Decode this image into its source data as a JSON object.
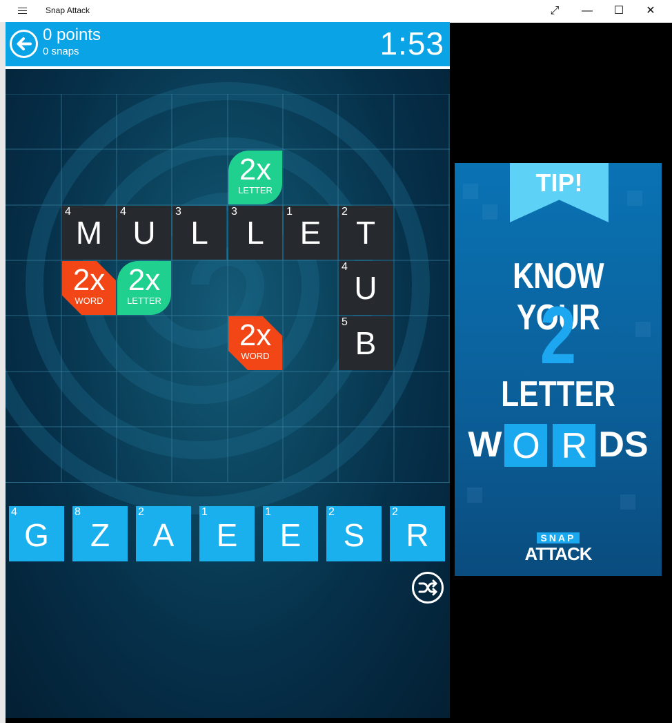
{
  "window": {
    "title": "Snap Attack",
    "menu_icon": "hamburger-icon",
    "buttons": [
      "expand-icon",
      "minimize-icon",
      "maximize-icon",
      "close-icon"
    ],
    "glyph_expand": "⤢",
    "glyph_minimize": "—",
    "glyph_maximize": "☐",
    "glyph_close": "✕"
  },
  "header": {
    "points": "0 points",
    "snaps": "0 snaps",
    "timer": "1:53",
    "back_icon": "back-arrow-icon"
  },
  "board": {
    "columns": 8,
    "rows": 7,
    "tiles": [
      {
        "letter": "M",
        "value": "4"
      },
      {
        "letter": "U",
        "value": "4"
      },
      {
        "letter": "L",
        "value": "3"
      },
      {
        "letter": "L",
        "value": "3"
      },
      {
        "letter": "E",
        "value": "1"
      },
      {
        "letter": "T",
        "value": "2"
      },
      {
        "letter": "U",
        "value": "4"
      },
      {
        "letter": "B",
        "value": "5"
      }
    ],
    "bonuses": [
      {
        "multiplier": "2x",
        "kind": "LETTER"
      },
      {
        "multiplier": "2x",
        "kind": "WORD"
      },
      {
        "multiplier": "2x",
        "kind": "LETTER"
      },
      {
        "multiplier": "2x",
        "kind": "WORD"
      }
    ]
  },
  "rack": {
    "tiles": [
      {
        "letter": "G",
        "value": "4"
      },
      {
        "letter": "Z",
        "value": "8"
      },
      {
        "letter": "A",
        "value": "2"
      },
      {
        "letter": "E",
        "value": "1"
      },
      {
        "letter": "E",
        "value": "1"
      },
      {
        "letter": "S",
        "value": "2"
      },
      {
        "letter": "R",
        "value": "2"
      }
    ],
    "shuffle_icon": "shuffle-icon"
  },
  "ad": {
    "tip": "TIP!",
    "line1": "KNOW YOUR",
    "number": "2",
    "line3": "LETTER",
    "line4": {
      "w": "W",
      "o": "O",
      "r": "R",
      "ds": "DS"
    },
    "logo_top": "SNAP",
    "logo_bottom": "ATTACK"
  },
  "colors": {
    "header": "#0aa4e6",
    "rack_tile": "#1ab0ee",
    "letter_bonus": "#1fd08f",
    "word_bonus": "#f24616",
    "board_tile": "#262a2e"
  }
}
